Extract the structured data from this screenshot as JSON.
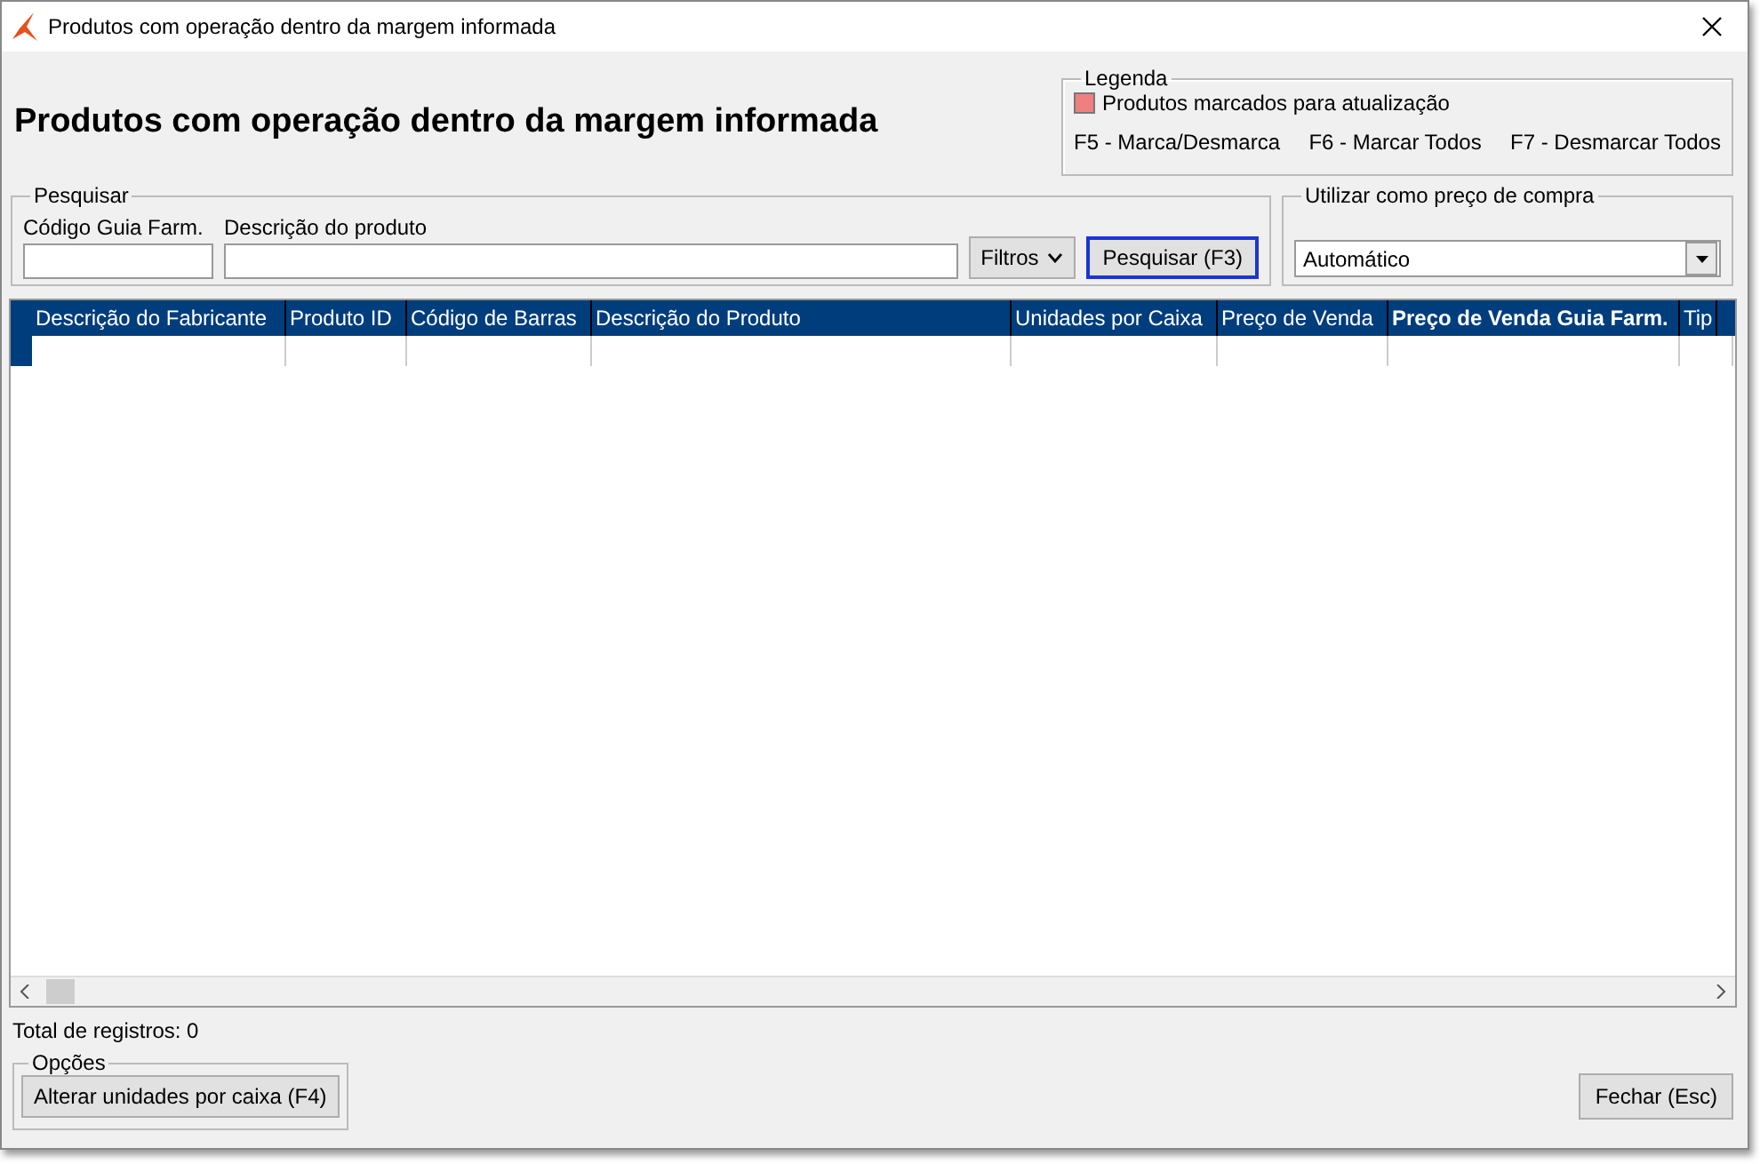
{
  "window": {
    "title": "Produtos com operação dentro da margem informada"
  },
  "heading": "Produtos com operação dentro da margem informada",
  "legend": {
    "title": "Legenda",
    "items": [
      {
        "label": "Produtos marcados para atualização",
        "color": "#f08080"
      }
    ],
    "shortcuts": [
      "F5 - Marca/Desmarca",
      "F6 - Marcar Todos",
      "F7 - Desmarcar Todos"
    ]
  },
  "search": {
    "title": "Pesquisar",
    "code_label": "Código Guia Farm.",
    "description_label": "Descrição do produto",
    "filters_button": "Filtros",
    "search_button": "Pesquisar (F3)"
  },
  "purchase_price": {
    "title": "Utilizar como preço de compra",
    "value": "Automático"
  },
  "table": {
    "columns": [
      {
        "label": "Descrição do Fabricante",
        "sorted": false
      },
      {
        "label": "Produto ID",
        "sorted": false
      },
      {
        "label": "Código de Barras",
        "sorted": false
      },
      {
        "label": "Descrição do Produto",
        "sorted": false
      },
      {
        "label": "Unidades por Caixa",
        "sorted": false
      },
      {
        "label": "Preço de Venda",
        "sorted": false
      },
      {
        "label": "Preço de Venda Guia Farm.",
        "sorted": true
      },
      {
        "label": "Tip",
        "sorted": false
      }
    ]
  },
  "total": "Total de registros: 0",
  "options": {
    "title": "Opções",
    "button": "Alterar unidades por caixa (F4)"
  },
  "close_button": "Fechar (Esc)"
}
